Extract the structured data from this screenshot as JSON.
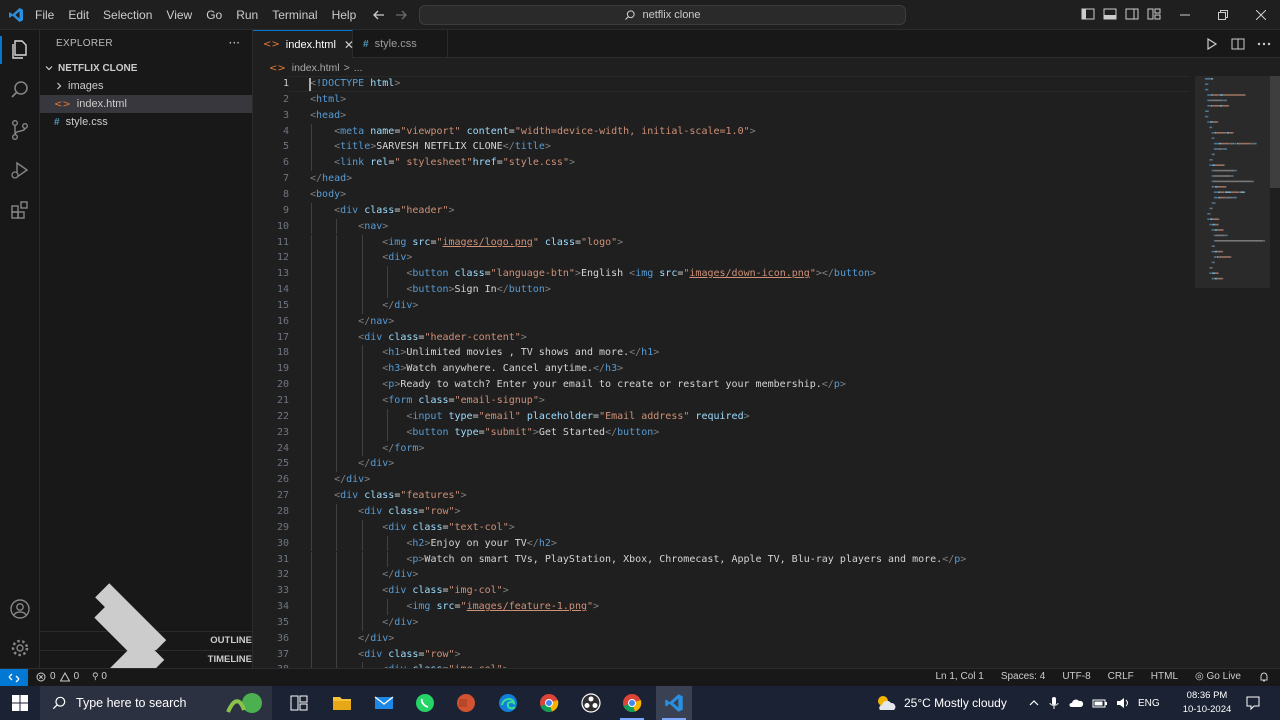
{
  "window": {
    "menu": [
      "File",
      "Edit",
      "Selection",
      "View",
      "Go",
      "Run",
      "Terminal",
      "Help"
    ],
    "search_text": "netflix clone"
  },
  "sidebar": {
    "title": "EXPLORER",
    "more": "···",
    "folder": "NETFLIX CLONE",
    "items": [
      {
        "label": "images",
        "type": "folder"
      },
      {
        "label": "index.html",
        "type": "html",
        "selected": true
      },
      {
        "label": "style.css",
        "type": "css"
      }
    ],
    "outline": "OUTLINE",
    "timeline": "TIMELINE"
  },
  "tabs": [
    {
      "label": "index.html",
      "active": true,
      "icon": "html-file-icon",
      "close": "✕"
    },
    {
      "label": "style.css",
      "active": false,
      "icon": "css-file-icon"
    }
  ],
  "breadcrumb": {
    "file": "index.html",
    "sep": ">",
    "tail": "..."
  },
  "editor": {
    "current_line": 1,
    "lines": [
      [
        [
          "br",
          "<"
        ],
        [
          "tag",
          "!DOCTYPE"
        ],
        [
          "text",
          " "
        ],
        [
          "attr",
          "html"
        ],
        [
          "br",
          ">"
        ]
      ],
      [
        [
          "br",
          "<"
        ],
        [
          "tag",
          "html"
        ],
        [
          "br",
          ">"
        ]
      ],
      [
        [
          "br",
          "<"
        ],
        [
          "tag",
          "head"
        ],
        [
          "br",
          ">"
        ]
      ],
      [
        [
          "text",
          "    "
        ],
        [
          "br",
          "<"
        ],
        [
          "tag",
          "meta"
        ],
        [
          "text",
          " "
        ],
        [
          "attr",
          "name"
        ],
        [
          "text",
          "="
        ],
        [
          "val",
          "\"viewport\""
        ],
        [
          "text",
          " "
        ],
        [
          "attr",
          "content"
        ],
        [
          "text",
          "="
        ],
        [
          "val",
          "\"width=device-width, initial-scale=1.0\""
        ],
        [
          "br",
          ">"
        ]
      ],
      [
        [
          "text",
          "    "
        ],
        [
          "br",
          "<"
        ],
        [
          "tag",
          "title"
        ],
        [
          "br",
          ">"
        ],
        [
          "text",
          "SARVESH NETFLIX CLONE"
        ],
        [
          "br",
          "</"
        ],
        [
          "tag",
          "title"
        ],
        [
          "br",
          ">"
        ]
      ],
      [
        [
          "text",
          "    "
        ],
        [
          "br",
          "<"
        ],
        [
          "tag",
          "link"
        ],
        [
          "text",
          " "
        ],
        [
          "attr",
          "rel"
        ],
        [
          "text",
          "="
        ],
        [
          "val",
          "\" stylesheet\""
        ],
        [
          "attr",
          "href"
        ],
        [
          "text",
          "="
        ],
        [
          "val",
          "\"style.css\""
        ],
        [
          "br",
          ">"
        ]
      ],
      [
        [
          "br",
          "</"
        ],
        [
          "tag",
          "head"
        ],
        [
          "br",
          ">"
        ]
      ],
      [
        [
          "br",
          "<"
        ],
        [
          "tag",
          "body"
        ],
        [
          "br",
          ">"
        ]
      ],
      [
        [
          "text",
          "    "
        ],
        [
          "br",
          "<"
        ],
        [
          "tag",
          "div"
        ],
        [
          "text",
          " "
        ],
        [
          "attr",
          "class"
        ],
        [
          "text",
          "="
        ],
        [
          "val",
          "\"header\""
        ],
        [
          "br",
          ">"
        ]
      ],
      [
        [
          "text",
          "        "
        ],
        [
          "br",
          "<"
        ],
        [
          "tag",
          "nav"
        ],
        [
          "br",
          ">"
        ]
      ],
      [
        [
          "text",
          "            "
        ],
        [
          "br",
          "<"
        ],
        [
          "tag",
          "img"
        ],
        [
          "text",
          " "
        ],
        [
          "attr",
          "src"
        ],
        [
          "text",
          "="
        ],
        [
          "val",
          "\""
        ],
        [
          "link",
          "images/logo.png"
        ],
        [
          "val",
          "\""
        ],
        [
          "text",
          " "
        ],
        [
          "attr",
          "class"
        ],
        [
          "text",
          "="
        ],
        [
          "val",
          "\"logo\""
        ],
        [
          "br",
          ">"
        ]
      ],
      [
        [
          "text",
          "            "
        ],
        [
          "br",
          "<"
        ],
        [
          "tag",
          "div"
        ],
        [
          "br",
          ">"
        ]
      ],
      [
        [
          "text",
          "                "
        ],
        [
          "br",
          "<"
        ],
        [
          "tag",
          "button"
        ],
        [
          "text",
          " "
        ],
        [
          "attr",
          "class"
        ],
        [
          "text",
          "="
        ],
        [
          "val",
          "\"language-btn\""
        ],
        [
          "br",
          ">"
        ],
        [
          "text",
          "English "
        ],
        [
          "br",
          "<"
        ],
        [
          "tag",
          "img"
        ],
        [
          "text",
          " "
        ],
        [
          "attr",
          "src"
        ],
        [
          "text",
          "="
        ],
        [
          "val",
          "\""
        ],
        [
          "link",
          "images/down-icon.png"
        ],
        [
          "val",
          "\""
        ],
        [
          "br",
          "></"
        ],
        [
          "tag",
          "button"
        ],
        [
          "br",
          ">"
        ]
      ],
      [
        [
          "text",
          "                "
        ],
        [
          "br",
          "<"
        ],
        [
          "tag",
          "button"
        ],
        [
          "br",
          ">"
        ],
        [
          "text",
          "Sign In"
        ],
        [
          "br",
          "</"
        ],
        [
          "tag",
          "button"
        ],
        [
          "br",
          ">"
        ]
      ],
      [
        [
          "text",
          "            "
        ],
        [
          "br",
          "</"
        ],
        [
          "tag",
          "div"
        ],
        [
          "br",
          ">"
        ]
      ],
      [
        [
          "text",
          "        "
        ],
        [
          "br",
          "</"
        ],
        [
          "tag",
          "nav"
        ],
        [
          "br",
          ">"
        ]
      ],
      [
        [
          "text",
          "        "
        ],
        [
          "br",
          "<"
        ],
        [
          "tag",
          "div"
        ],
        [
          "text",
          " "
        ],
        [
          "attr",
          "class"
        ],
        [
          "text",
          "="
        ],
        [
          "val",
          "\"header-content\""
        ],
        [
          "br",
          ">"
        ]
      ],
      [
        [
          "text",
          "            "
        ],
        [
          "br",
          "<"
        ],
        [
          "tag",
          "h1"
        ],
        [
          "br",
          ">"
        ],
        [
          "text",
          "Unlimited movies , TV shows and more."
        ],
        [
          "br",
          "</"
        ],
        [
          "tag",
          "h1"
        ],
        [
          "br",
          ">"
        ]
      ],
      [
        [
          "text",
          "            "
        ],
        [
          "br",
          "<"
        ],
        [
          "tag",
          "h3"
        ],
        [
          "br",
          ">"
        ],
        [
          "text",
          "Watch anywhere. Cancel anytime."
        ],
        [
          "br",
          "</"
        ],
        [
          "tag",
          "h3"
        ],
        [
          "br",
          ">"
        ]
      ],
      [
        [
          "text",
          "            "
        ],
        [
          "br",
          "<"
        ],
        [
          "tag",
          "p"
        ],
        [
          "br",
          ">"
        ],
        [
          "text",
          "Ready to watch? Enter your email to create or restart your membership."
        ],
        [
          "br",
          "</"
        ],
        [
          "tag",
          "p"
        ],
        [
          "br",
          ">"
        ]
      ],
      [
        [
          "text",
          "            "
        ],
        [
          "br",
          "<"
        ],
        [
          "tag",
          "form"
        ],
        [
          "text",
          " "
        ],
        [
          "attr",
          "class"
        ],
        [
          "text",
          "="
        ],
        [
          "val",
          "\"email-signup\""
        ],
        [
          "br",
          ">"
        ]
      ],
      [
        [
          "text",
          "                "
        ],
        [
          "br",
          "<"
        ],
        [
          "tag",
          "input"
        ],
        [
          "text",
          " "
        ],
        [
          "attr",
          "type"
        ],
        [
          "text",
          "="
        ],
        [
          "val",
          "\"email\""
        ],
        [
          "text",
          " "
        ],
        [
          "attr",
          "placeholder"
        ],
        [
          "text",
          "="
        ],
        [
          "val",
          "\"Email address\""
        ],
        [
          "text",
          " "
        ],
        [
          "attr",
          "required"
        ],
        [
          "br",
          ">"
        ]
      ],
      [
        [
          "text",
          "                "
        ],
        [
          "br",
          "<"
        ],
        [
          "tag",
          "button"
        ],
        [
          "text",
          " "
        ],
        [
          "attr",
          "type"
        ],
        [
          "text",
          "="
        ],
        [
          "val",
          "\"submit\""
        ],
        [
          "br",
          ">"
        ],
        [
          "text",
          "Get Started"
        ],
        [
          "br",
          "</"
        ],
        [
          "tag",
          "button"
        ],
        [
          "br",
          ">"
        ]
      ],
      [
        [
          "text",
          "            "
        ],
        [
          "br",
          "</"
        ],
        [
          "tag",
          "form"
        ],
        [
          "br",
          ">"
        ]
      ],
      [
        [
          "text",
          "        "
        ],
        [
          "br",
          "</"
        ],
        [
          "tag",
          "div"
        ],
        [
          "br",
          ">"
        ]
      ],
      [
        [
          "text",
          "    "
        ],
        [
          "br",
          "</"
        ],
        [
          "tag",
          "div"
        ],
        [
          "br",
          ">"
        ]
      ],
      [
        [
          "text",
          "    "
        ],
        [
          "br",
          "<"
        ],
        [
          "tag",
          "div"
        ],
        [
          "text",
          " "
        ],
        [
          "attr",
          "class"
        ],
        [
          "text",
          "="
        ],
        [
          "val",
          "\"features\""
        ],
        [
          "br",
          ">"
        ]
      ],
      [
        [
          "text",
          "        "
        ],
        [
          "br",
          "<"
        ],
        [
          "tag",
          "div"
        ],
        [
          "text",
          " "
        ],
        [
          "attr",
          "class"
        ],
        [
          "text",
          "="
        ],
        [
          "val",
          "\"row\""
        ],
        [
          "br",
          ">"
        ]
      ],
      [
        [
          "text",
          "            "
        ],
        [
          "br",
          "<"
        ],
        [
          "tag",
          "div"
        ],
        [
          "text",
          " "
        ],
        [
          "attr",
          "class"
        ],
        [
          "text",
          "="
        ],
        [
          "val",
          "\"text-col\""
        ],
        [
          "br",
          ">"
        ]
      ],
      [
        [
          "text",
          "                "
        ],
        [
          "br",
          "<"
        ],
        [
          "tag",
          "h2"
        ],
        [
          "br",
          ">"
        ],
        [
          "text",
          "Enjoy on your TV"
        ],
        [
          "br",
          "</"
        ],
        [
          "tag",
          "h2"
        ],
        [
          "br",
          ">"
        ]
      ],
      [
        [
          "text",
          "                "
        ],
        [
          "br",
          "<"
        ],
        [
          "tag",
          "p"
        ],
        [
          "br",
          ">"
        ],
        [
          "text",
          "Watch on smart TVs, PlayStation, Xbox, Chromecast, Apple TV, Blu-ray players and more."
        ],
        [
          "br",
          "</"
        ],
        [
          "tag",
          "p"
        ],
        [
          "br",
          ">"
        ]
      ],
      [
        [
          "text",
          "            "
        ],
        [
          "br",
          "</"
        ],
        [
          "tag",
          "div"
        ],
        [
          "br",
          ">"
        ]
      ],
      [
        [
          "text",
          "            "
        ],
        [
          "br",
          "<"
        ],
        [
          "tag",
          "div"
        ],
        [
          "text",
          " "
        ],
        [
          "attr",
          "class"
        ],
        [
          "text",
          "="
        ],
        [
          "val",
          "\"img-col\""
        ],
        [
          "br",
          ">"
        ]
      ],
      [
        [
          "text",
          "                "
        ],
        [
          "br",
          "<"
        ],
        [
          "tag",
          "img"
        ],
        [
          "text",
          " "
        ],
        [
          "attr",
          "src"
        ],
        [
          "text",
          "="
        ],
        [
          "val",
          "\""
        ],
        [
          "link",
          "images/feature-1.png"
        ],
        [
          "val",
          "\""
        ],
        [
          "br",
          ">"
        ]
      ],
      [
        [
          "text",
          "            "
        ],
        [
          "br",
          "</"
        ],
        [
          "tag",
          "div"
        ],
        [
          "br",
          ">"
        ]
      ],
      [
        [
          "text",
          "        "
        ],
        [
          "br",
          "</"
        ],
        [
          "tag",
          "div"
        ],
        [
          "br",
          ">"
        ]
      ],
      [
        [
          "text",
          "        "
        ],
        [
          "br",
          "<"
        ],
        [
          "tag",
          "div"
        ],
        [
          "text",
          " "
        ],
        [
          "attr",
          "class"
        ],
        [
          "text",
          "="
        ],
        [
          "val",
          "\"row\""
        ],
        [
          "br",
          ">"
        ]
      ],
      [
        [
          "text",
          "            "
        ],
        [
          "br",
          "<"
        ],
        [
          "tag",
          "div"
        ],
        [
          "text",
          " "
        ],
        [
          "attr",
          "class"
        ],
        [
          "text",
          "="
        ],
        [
          "val",
          "\"img-col\""
        ],
        [
          "br",
          ">"
        ]
      ]
    ]
  },
  "statusbar": {
    "errors": "0",
    "warnings": "0",
    "ports": "0",
    "position": "Ln 1, Col 1",
    "spaces": "Spaces: 4",
    "encoding": "UTF-8",
    "eol": "CRLF",
    "language": "HTML",
    "golive": "Go Live"
  },
  "taskbar": {
    "search_placeholder": "Type here to search",
    "weather": "25°C  Mostly cloudy",
    "lang": "ENG",
    "time": "08:36 PM",
    "date": "10-10-2024"
  },
  "colors": {
    "accent": "#0078d4",
    "tag": "#569cd6",
    "attr": "#9cdcfe",
    "string": "#ce9178"
  }
}
